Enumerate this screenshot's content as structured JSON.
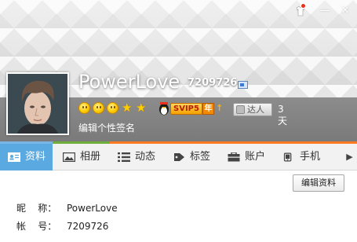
{
  "window": {
    "skin_icon": "skin-shirt-icon",
    "minimize_glyph": "—",
    "close_glyph": "✕"
  },
  "profile": {
    "nickname": "PowerLove",
    "qq_number": "7209726",
    "signature": "编辑个性签名",
    "level_icons": [
      "sun",
      "sun",
      "sun",
      "star",
      "star"
    ],
    "vip": {
      "label": "SVIP5",
      "year_badge": "年",
      "arrow": "↑"
    },
    "daren": {
      "label": "达人",
      "days": "3天"
    }
  },
  "tabs": [
    {
      "label": "资料",
      "icon": "profile-card-icon",
      "active": true
    },
    {
      "label": "相册",
      "icon": "photo-album-icon",
      "active": false
    },
    {
      "label": "动态",
      "icon": "feed-list-icon",
      "active": false
    },
    {
      "label": "标签",
      "icon": "tag-icon",
      "active": false
    },
    {
      "label": "账户",
      "icon": "wallet-icon",
      "active": false
    },
    {
      "label": "手机",
      "icon": "phone-icon",
      "active": false
    }
  ],
  "tab_more_glyph": "▶",
  "content": {
    "edit_button": "编辑资料",
    "rows": [
      {
        "label": "昵    称：",
        "value": "PowerLove"
      },
      {
        "label": "帐    号：",
        "value": "7209726"
      }
    ]
  },
  "colors": {
    "active_tab": "#5aa9e0",
    "header_band": "#7f7f7f",
    "star": "#ffcc00"
  }
}
